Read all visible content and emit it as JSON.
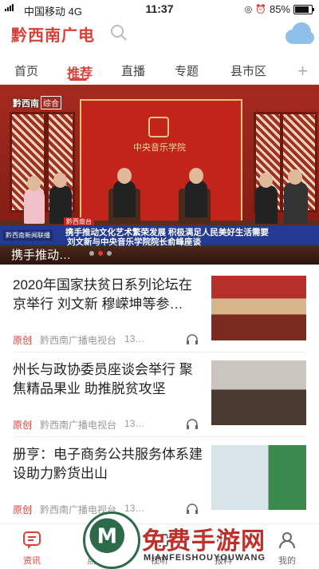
{
  "status_bar": {
    "carrier": "中国移动",
    "network": "4G",
    "time": "11:37",
    "battery": "85%",
    "battery_level": 0.85
  },
  "header": {
    "logo": "黔西南广电",
    "search_icon": "search-icon",
    "weather_icon": "cloud-icon"
  },
  "tabs": [
    {
      "label": "首页"
    },
    {
      "label": "推荐",
      "active": true
    },
    {
      "label": "直播"
    },
    {
      "label": "专题"
    },
    {
      "label": "县市区"
    }
  ],
  "banner": {
    "channel": "黔西南",
    "channel_sub": "综合",
    "top_tag": "黔西南台",
    "caption_line1": "携手推动文化艺术繁荣发展 积极满足人民美好生活需要",
    "caption_line2": "刘文新与中央音乐学院院长俞峰座谈",
    "caption_tag": "黔西南新闻联播",
    "backdrop_text": "中央音乐学院",
    "title": "携手推动…",
    "slides": 3,
    "active_slide": 2
  },
  "news": [
    {
      "title": "2020年国家扶贫日系列论坛在京举行 刘文新 穆嵘坤等参…",
      "tag": "原创",
      "source": "黔西南广播电视台",
      "count": "13…"
    },
    {
      "title": "州长与政协委员座谈会举行 聚焦精品果业 助推脱贫攻坚",
      "tag": "原创",
      "source": "黔西南广播电视台",
      "count": "13…"
    },
    {
      "title": "册亨：电子商务公共服务体系建设助力黔货出山",
      "tag": "原创",
      "source": "黔西南广播电视台",
      "count": "13…"
    }
  ],
  "bottom_nav": [
    {
      "label": "资讯",
      "icon": "chat-icon",
      "active": true
    },
    {
      "label": "点播",
      "icon": "play-icon"
    },
    {
      "label": "视听",
      "icon": "tv-icon"
    },
    {
      "label": "报料",
      "icon": "mic-icon"
    },
    {
      "label": "我的",
      "icon": "user-icon"
    }
  ],
  "watermark": {
    "text": "免费手游网",
    "sub": "MIANFEISHOUYOUWANG"
  },
  "colors": {
    "accent": "#d9403a",
    "caption_blue": "#1e3ca0"
  }
}
